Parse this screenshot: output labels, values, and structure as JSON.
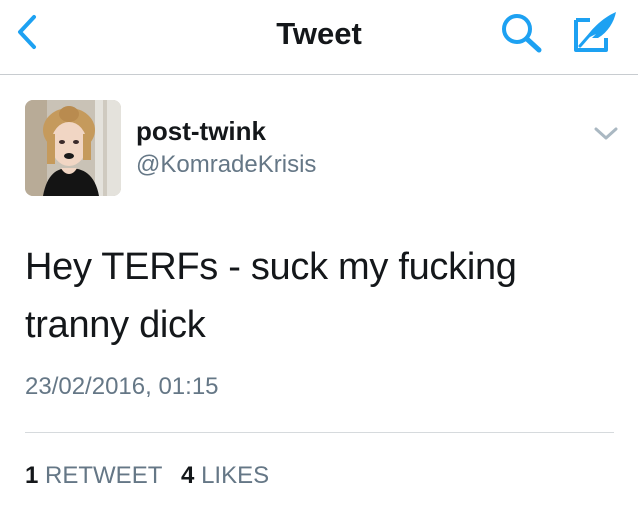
{
  "header": {
    "title": "Tweet",
    "back_icon": "chevron-left-icon",
    "search_icon": "search-icon",
    "compose_icon": "compose-feather-icon"
  },
  "tweet": {
    "display_name": "post-twink",
    "handle": "@KomradeKrisis",
    "text": "Hey TERFs - suck my fucking tranny dick",
    "timestamp": "23/02/2016, 01:15",
    "retweet_count": "1",
    "retweet_label": "RETWEET",
    "like_count": "4",
    "like_label": "LIKES",
    "menu_icon": "chevron-down-icon"
  },
  "colors": {
    "accent": "#1da1f2",
    "text": "#14171a",
    "muted": "#657786",
    "divider": "#d6dadd"
  }
}
